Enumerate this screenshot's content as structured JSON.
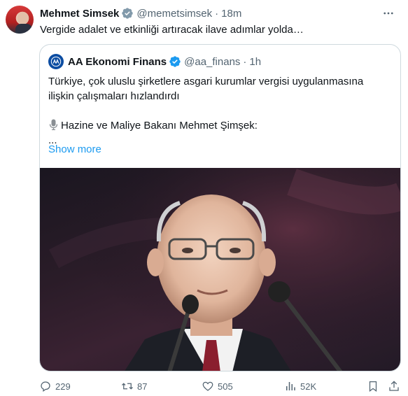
{
  "author": {
    "name": "Mehmet Simsek",
    "handle": "@memetsimsek",
    "separator": "·",
    "time": "18m"
  },
  "tweet_text": "Vergide adalet ve etkinliği artıracak ilave adımlar yolda…",
  "quote": {
    "name": "AA Ekonomi Finans",
    "handle": "@aa_finans",
    "separator": "·",
    "time": "1h",
    "line1": "Türkiye, çok uluslu şirketlere asgari kurumlar vergisi uygulanmasına",
    "line2": "ilişkin çalışmaları hızlandırdı",
    "line3": "Hazine ve Maliye Bakanı Mehmet Şimşek:",
    "line4": "...",
    "show_more": "Show more"
  },
  "actions": {
    "replies": "229",
    "reposts": "87",
    "likes": "505",
    "views": "52K"
  },
  "colors": {
    "text": "#0f1419",
    "secondary": "#536471",
    "link": "#1d9bf0",
    "verified": "#1d9bf0",
    "border": "#cfd9de"
  },
  "icons": [
    "verified-badge-icon",
    "more-icon",
    "microphone-icon",
    "reply-icon",
    "repost-icon",
    "like-icon",
    "views-icon",
    "bookmark-icon",
    "share-icon"
  ]
}
